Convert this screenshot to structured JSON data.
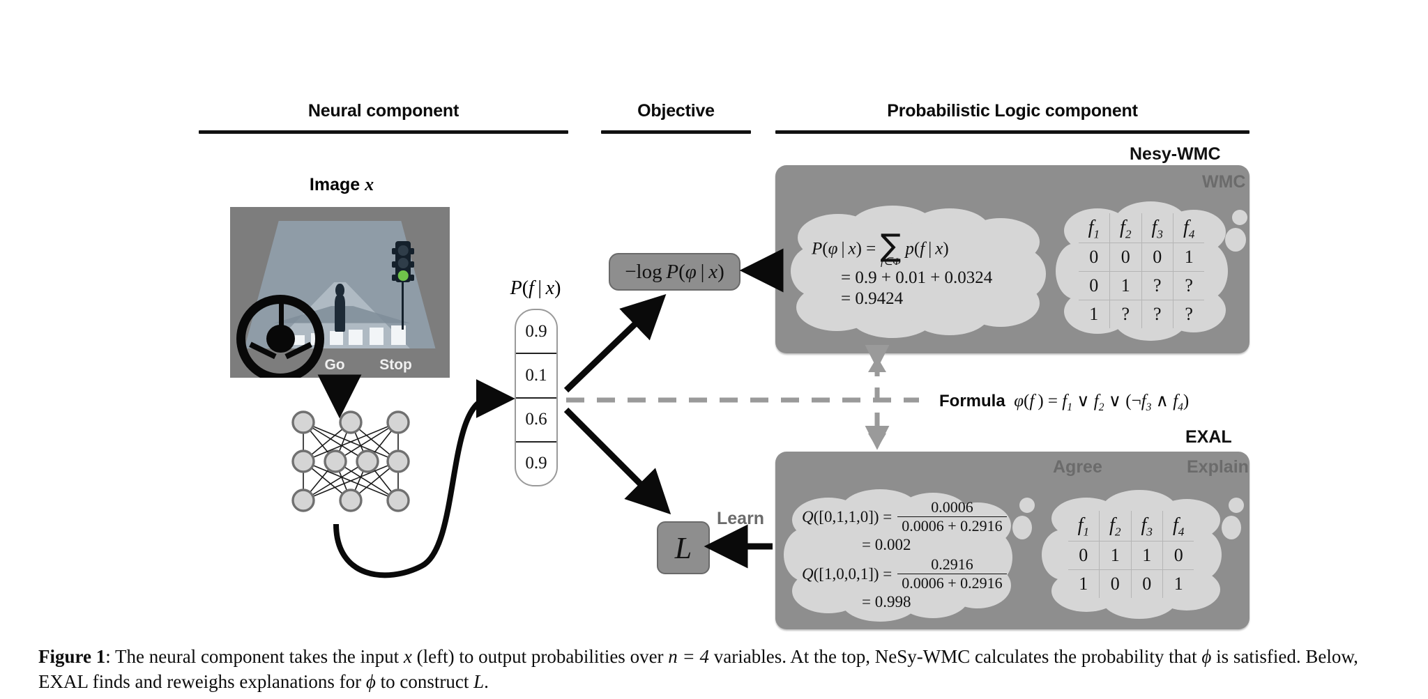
{
  "figure": {
    "columns": [
      {
        "key": "neural",
        "label": "Neural component"
      },
      {
        "key": "objective",
        "label": "Objective"
      },
      {
        "key": "logic",
        "label": "Probabilistic Logic component"
      }
    ],
    "image_panel": {
      "title_prefix": "Image ",
      "title_var": "x",
      "labels": [
        "Go",
        "Stop"
      ],
      "traffic_light_state": "green",
      "scene_bg": "#7d7d7d",
      "road_color": "#8a97a3"
    },
    "prob_bar": {
      "caption_prefix": "P(",
      "caption": "P(f | x)",
      "values": [
        "0.9",
        "0.1",
        "0.6",
        "0.9"
      ]
    },
    "objective_box": {
      "label": "−log P(ϕ | x)"
    },
    "loss_box": {
      "label": "L",
      "arrow_label": "Learn"
    },
    "formula": {
      "prefix": "Formula",
      "body": "ϕ(f) = f₁ ∨ f₂ ∨ (¬f₃ ∧ f₄)"
    },
    "nesy_wmc": {
      "title": "Nesy-WMC",
      "inner_tag": "WMC",
      "equation_lines": [
        "P(ϕ | x) = ∑_{f∈Φ} p(f | x)",
        "= 0.9 + 0.01 + 0.0324",
        "= 0.9424"
      ],
      "eq_sum_label": "f∈Φ",
      "eq_line2": "= 0.9 + 0.01 + 0.0324",
      "eq_line3": "= 0.9424",
      "table": {
        "headers": [
          "f1",
          "f2",
          "f3",
          "f4"
        ],
        "rows": [
          [
            "0",
            "0",
            "0",
            "1"
          ],
          [
            "0",
            "1",
            "?",
            "?"
          ],
          [
            "1",
            "?",
            "?",
            "?"
          ]
        ]
      }
    },
    "exal": {
      "title": "EXAL",
      "tag_agree": "Agree",
      "tag_explain": "Explain",
      "equations": [
        {
          "lhs": "Q([0,1,1,0]) =",
          "num": "0.0006",
          "den": "0.0006 + 0.2916",
          "result": "= 0.002"
        },
        {
          "lhs": "Q([1,0,0,1]) =",
          "num": "0.2916",
          "den": "0.0006 + 0.2916",
          "result": "= 0.998"
        }
      ],
      "table": {
        "headers": [
          "f1",
          "f2",
          "f3",
          "f4"
        ],
        "rows": [
          [
            "0",
            "1",
            "1",
            "0"
          ],
          [
            "1",
            "0",
            "0",
            "1"
          ]
        ]
      }
    },
    "caption": {
      "label": "Figure 1",
      "separator": ": ",
      "text_1": "The neural component takes the input ",
      "var_x": "x",
      "text_2": " (left) to output probabilities over ",
      "var_n": "n = 4",
      "text_3": " variables. At the top, NeSy-WMC calculates the probability that ",
      "var_phi": "ϕ",
      "text_4": " is satisfied. Below, EXAL finds and reweighs explanations for ",
      "var_phi2": "ϕ",
      "text_5": " to construct ",
      "var_L": "L",
      "text_6": "."
    },
    "colors": {
      "box_gray": "#8e8e8e",
      "cloud_gray": "#d6d6d6",
      "tag_gray": "#6b6b6b",
      "arrow_black": "#0a0a0a",
      "dashed_gray": "#9a9a9a",
      "light_green": "#6fc24a"
    }
  }
}
